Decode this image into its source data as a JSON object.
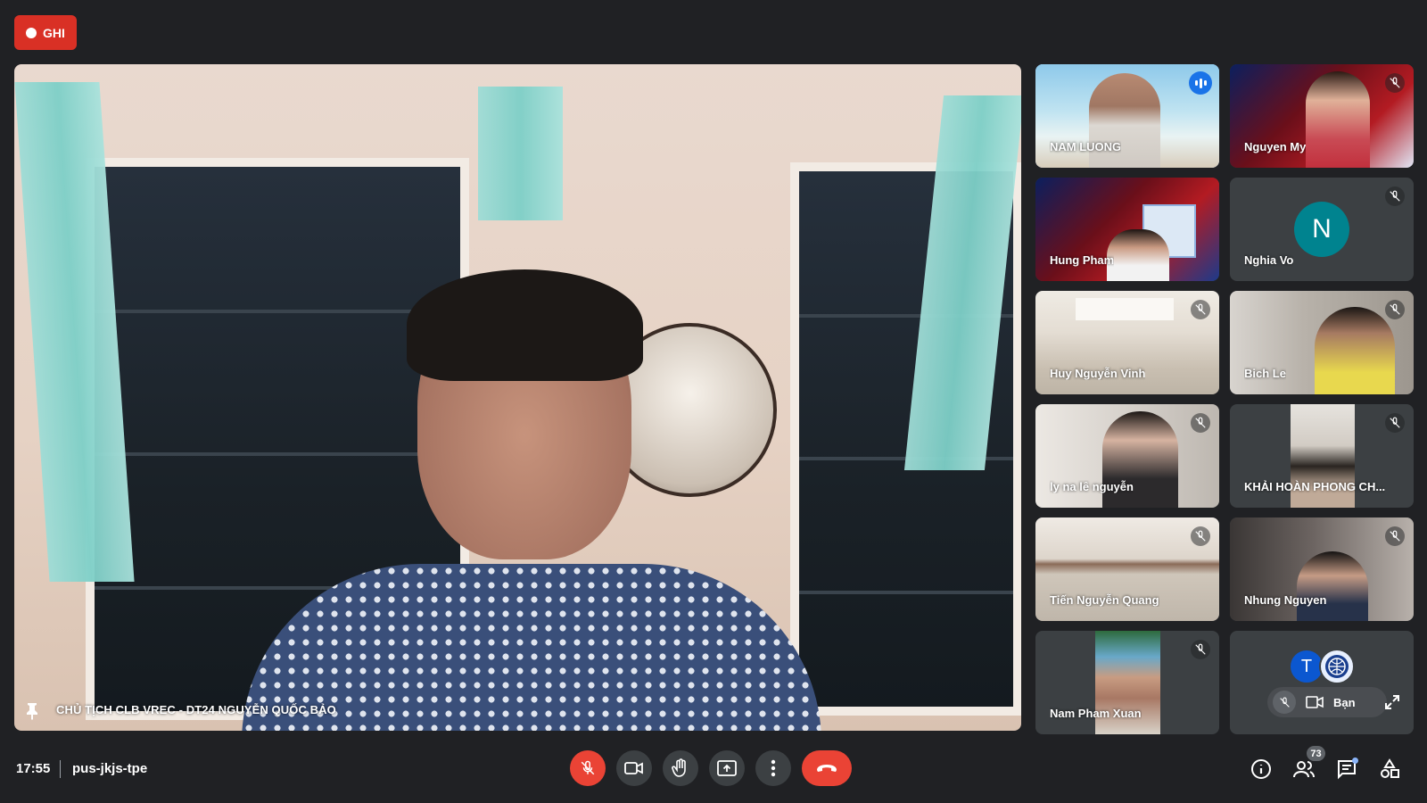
{
  "recording": {
    "label": "GHI",
    "color": "#d93025"
  },
  "main_speaker": {
    "name": "CHỦ TỊCH CLB VREC - DT24 NGUYỄN QUỐC BẢO",
    "pinned": true
  },
  "participants": [
    {
      "name": "NAM LUONG",
      "speaking": true,
      "muted": false,
      "video": true
    },
    {
      "name": "Nguyen My",
      "speaking": false,
      "muted": true,
      "video": true
    },
    {
      "name": "Hung Pham",
      "speaking": false,
      "muted": false,
      "video": true
    },
    {
      "name": "Nghia Vo",
      "speaking": false,
      "muted": true,
      "video": false,
      "avatar_letter": "N",
      "avatar_color": "#00838f"
    },
    {
      "name": "Huy Nguyễn Vinh",
      "speaking": false,
      "muted": true,
      "video": true
    },
    {
      "name": "Bich Le",
      "speaking": false,
      "muted": true,
      "video": true
    },
    {
      "name": "ly na lê nguyễn",
      "speaking": false,
      "muted": true,
      "video": true
    },
    {
      "name": "KHẢI HOÀN PHONG CH...",
      "speaking": false,
      "muted": true,
      "video": true
    },
    {
      "name": "Tiến Nguyễn Quang",
      "speaking": false,
      "muted": true,
      "video": true
    },
    {
      "name": "Nhung Nguyen",
      "speaking": false,
      "muted": true,
      "video": true
    },
    {
      "name": "Nam Pham Xuan",
      "speaking": false,
      "muted": true,
      "video": true
    }
  ],
  "self_tile": {
    "label": "Bạn",
    "avatar_letter": "T",
    "avatar_color": "#0b57d0"
  },
  "meeting": {
    "time": "17:55",
    "code": "pus-jkjs-tpe"
  },
  "controls": [
    "mic-off",
    "camera",
    "raise-hand",
    "present",
    "more-options",
    "leave-call"
  ],
  "people_count": "73",
  "right_icons": [
    "info-icon",
    "people-icon",
    "chat-icon",
    "activities-icon"
  ]
}
